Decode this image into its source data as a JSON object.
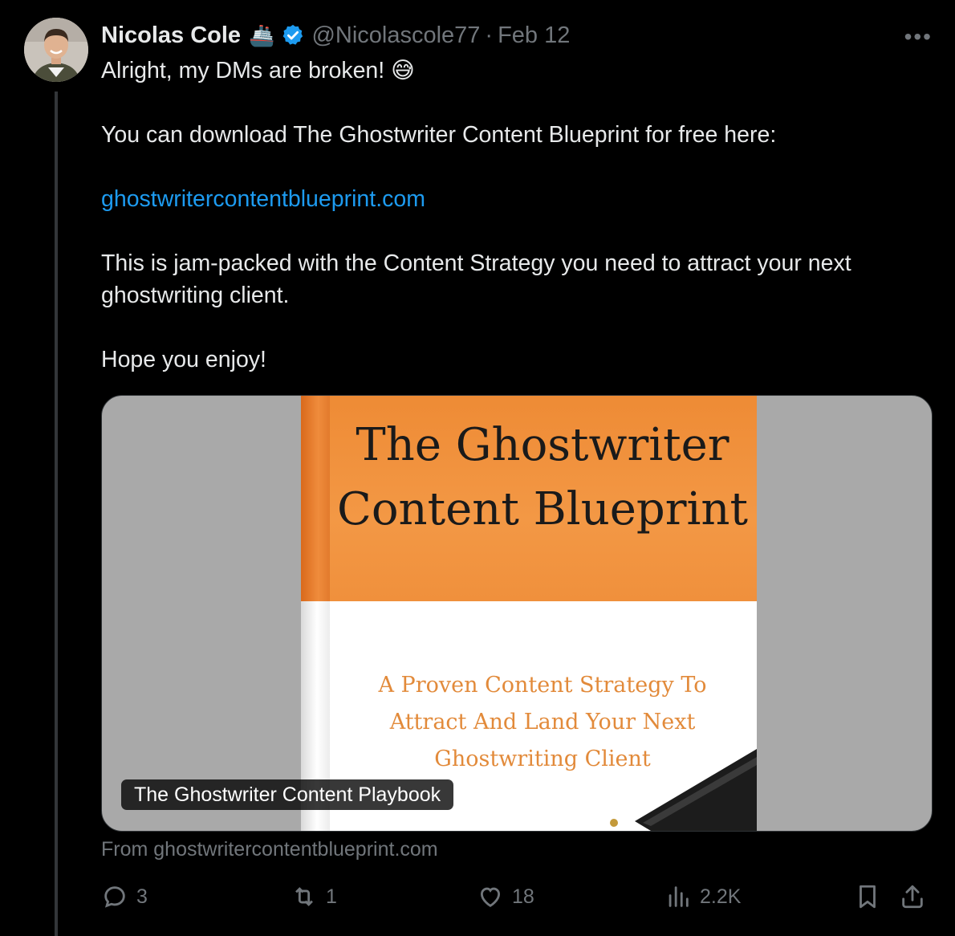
{
  "author": {
    "name": "Nicolas Cole",
    "name_emoji": "🚢",
    "handle": "@Nicolascole77",
    "separator": "·",
    "date": "Feb 12",
    "verified": true
  },
  "tweet": {
    "line1": "Alright, my DMs are broken! 😅",
    "line2": "You can download The Ghostwriter Content Blueprint for free here:",
    "link": "ghostwritercontentblueprint.com",
    "line3": "This is jam-packed with the Content Strategy you need to attract your next ghostwriting client.",
    "line4": "Hope you enjoy!"
  },
  "card": {
    "book_title_line1": "The Ghostwriter",
    "book_title_line2": "Content Blueprint",
    "book_subtitle_line1": "A Proven Content Strategy To",
    "book_subtitle_line2": "Attract And Land Your Next",
    "book_subtitle_line3": "Ghostwriting Client",
    "caption": "The Ghostwriter Content Playbook",
    "source": "From ghostwritercontentblueprint.com"
  },
  "actions": {
    "replies": "3",
    "reposts": "1",
    "likes": "18",
    "views": "2.2K"
  },
  "icons": {
    "more": "more-icon",
    "reply": "reply-icon",
    "repost": "repost-icon",
    "like": "heart-icon",
    "views": "views-icon",
    "bookmark": "bookmark-icon",
    "share": "share-icon"
  },
  "colors": {
    "background": "#000000",
    "text": "#e7e9ea",
    "muted": "#71767b",
    "link": "#1d9bf0",
    "verified": "#1d9bf0",
    "book_orange": "#f0903c"
  }
}
